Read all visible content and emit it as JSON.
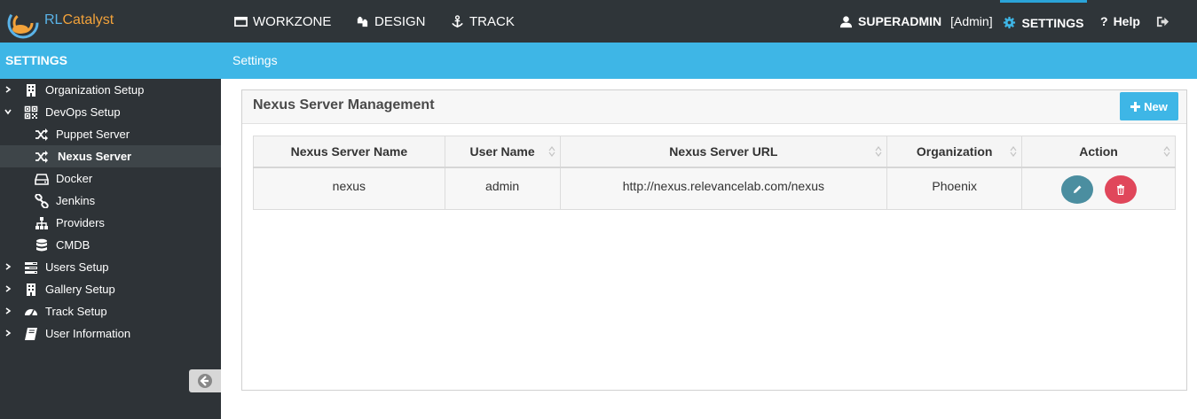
{
  "brand": {
    "logo_rl": "RL",
    "logo_rest": "Catalyst",
    "logo_alt": "RLCatalyst"
  },
  "topnav": {
    "workzone": "WORKZONE",
    "design": "DESIGN",
    "track": "TRACK",
    "user": "SUPERADMIN",
    "role": "[Admin]",
    "settings": "SETTINGS",
    "help": "Help"
  },
  "sidebar": {
    "title": "SETTINGS",
    "items": [
      {
        "label": "Organization Setup",
        "icon": "building-icon",
        "expandable": true,
        "expanded": false
      },
      {
        "label": "DevOps Setup",
        "icon": "qrcode-icon",
        "expandable": true,
        "expanded": true
      },
      {
        "label": "Puppet Server",
        "icon": "shuffle-icon"
      },
      {
        "label": "Nexus Server",
        "icon": "shuffle-icon",
        "active": true
      },
      {
        "label": "Docker",
        "icon": "hdd-icon"
      },
      {
        "label": "Jenkins",
        "icon": "link-icon"
      },
      {
        "label": "Providers",
        "icon": "sitemap-icon"
      },
      {
        "label": "CMDB",
        "icon": "database-icon"
      },
      {
        "label": "Users Setup",
        "icon": "tasks-icon",
        "expandable": true,
        "expanded": false
      },
      {
        "label": "Gallery Setup",
        "icon": "building-icon",
        "expandable": true,
        "expanded": false
      },
      {
        "label": "Track Setup",
        "icon": "dashboard-icon",
        "expandable": true,
        "expanded": false
      },
      {
        "label": "User Information",
        "icon": "book-icon",
        "expandable": true,
        "expanded": false
      }
    ]
  },
  "content": {
    "breadcrumb": "Settings",
    "panel_title": "Nexus Server Management",
    "new_button": "New",
    "table": {
      "columns": [
        "Nexus Server Name",
        "User Name",
        "Nexus Server URL",
        "Organization",
        "Action"
      ],
      "rows": [
        {
          "name": "nexus",
          "user": "admin",
          "url": "http://nexus.relevancelab.com/nexus",
          "org": "Phoenix"
        }
      ]
    }
  },
  "colors": {
    "topbar": "#2f3539",
    "sidebar": "#2e3337",
    "accent": "#3eb6e6",
    "edit": "#4b8ea0",
    "delete": "#e0475b"
  }
}
